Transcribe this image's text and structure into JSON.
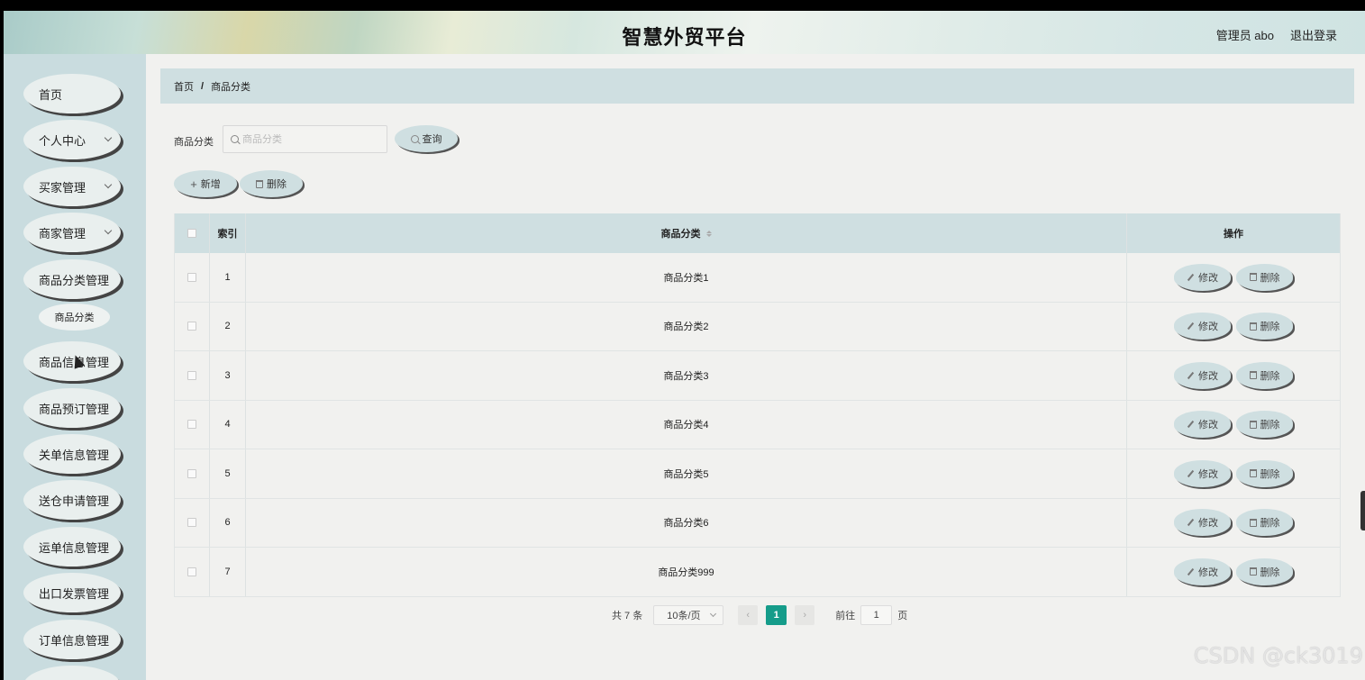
{
  "header": {
    "title": "智慧外贸平台",
    "user": "管理员 abo",
    "logout": "退出登录"
  },
  "sidebar": {
    "items": [
      {
        "label": "首页",
        "has_chevron": false
      },
      {
        "label": "个人中心",
        "has_chevron": true
      },
      {
        "label": "买家管理",
        "has_chevron": true
      },
      {
        "label": "商家管理",
        "has_chevron": true
      },
      {
        "label": "商品分类管理",
        "has_chevron": false
      },
      {
        "label": "商品分类",
        "sub": true
      },
      {
        "label": "商品信息管理",
        "has_chevron": false
      },
      {
        "label": "商品预订管理",
        "has_chevron": false
      },
      {
        "label": "关单信息管理",
        "has_chevron": false
      },
      {
        "label": "送仓申请管理",
        "has_chevron": false
      },
      {
        "label": "运单信息管理",
        "has_chevron": false
      },
      {
        "label": "出口发票管理",
        "has_chevron": false
      },
      {
        "label": "订单信息管理",
        "has_chevron": false
      }
    ]
  },
  "breadcrumb": {
    "home": "首页",
    "separator": "/",
    "current": "商品分类"
  },
  "search": {
    "label": "商品分类",
    "placeholder": "商品分类",
    "value": "",
    "button": "查询"
  },
  "toolbar": {
    "add": "新增",
    "delete": "删除"
  },
  "table": {
    "headers": {
      "index": "索引",
      "category": "商品分类",
      "ops": "操作"
    },
    "rows": [
      {
        "index": "1",
        "category": "商品分类1"
      },
      {
        "index": "2",
        "category": "商品分类2"
      },
      {
        "index": "3",
        "category": "商品分类3"
      },
      {
        "index": "4",
        "category": "商品分类4"
      },
      {
        "index": "5",
        "category": "商品分类5"
      },
      {
        "index": "6",
        "category": "商品分类6"
      },
      {
        "index": "7",
        "category": "商品分类999"
      }
    ],
    "row_actions": {
      "edit": "修改",
      "delete": "删除"
    }
  },
  "pagination": {
    "total": "共 7 条",
    "page_size": "10条/页",
    "current_page": "1",
    "goto_prefix": "前往",
    "goto_value": "1",
    "goto_suffix": "页"
  },
  "watermark": "CSDN @ck3019",
  "colors": {
    "accent": "#159c8a",
    "pill": "#cfdfe1",
    "sidebar": "#c9dcdf"
  }
}
